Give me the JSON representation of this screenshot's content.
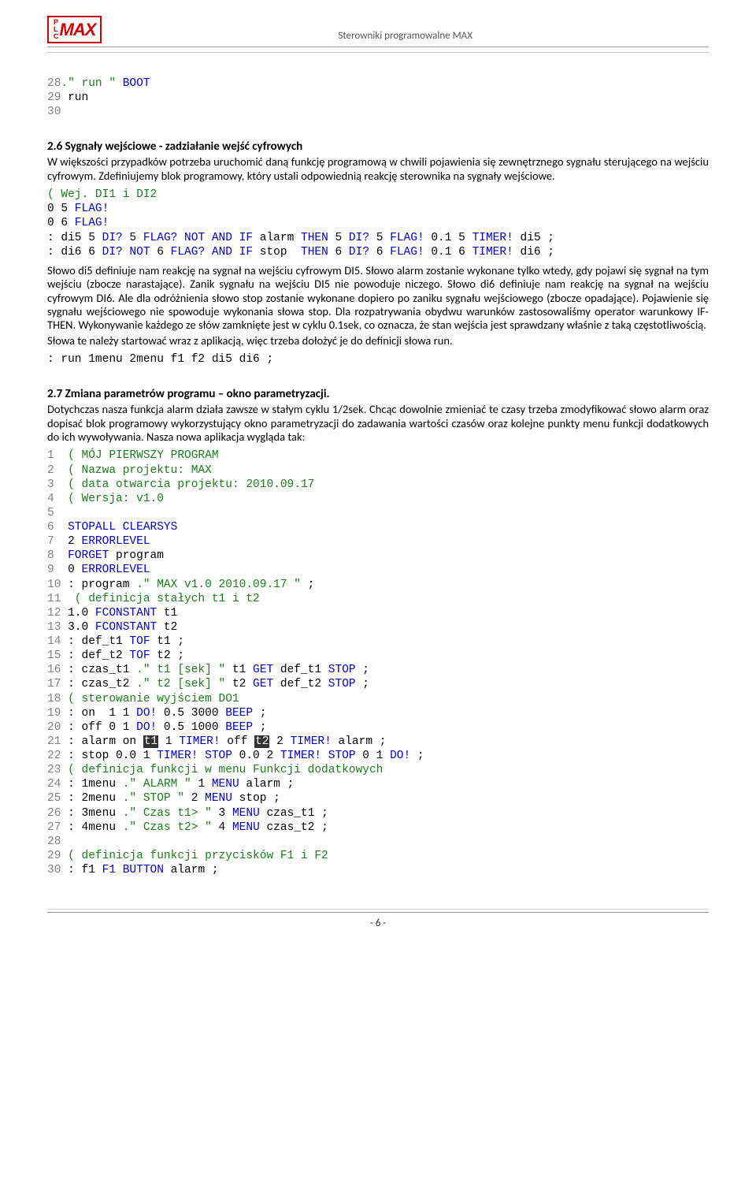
{
  "header": {
    "logo_small": "PLC",
    "logo_big": "MAX",
    "title": "Sterowniki programowalne MAX"
  },
  "code_top": {
    "l28_ln": "28",
    "l28_a": ".\" run \"",
    "l28_b": " BOOT",
    "l29_ln": "29",
    "l29_a": " run",
    "l30_ln": "30"
  },
  "section26": {
    "title": "2.6 Sygnały wejściowe - zadziałanie wejść cyfrowych",
    "p1": "W większości przypadków potrzeba uruchomić daną funkcję programową w chwili pojawienia się zewnętrznego sygnału sterującego na wejściu cyfrowym. Zdefiniujemy blok programowy, który ustali odpowiednią reakcję sterownika na sygnały wejściowe."
  },
  "code_di": {
    "c1": "( Wej. DI1 i DI2",
    "c2a": "0 5",
    "c2b": " FLAG!",
    "c3a": "0 6",
    "c3b": " FLAG!",
    "c4a": ": di5 5",
    "c4b": " DI?",
    "c4c": " 5",
    "c4d": " FLAG? NOT AND IF",
    "c4e": " alarm",
    "c4f": " THEN",
    "c4g": " 5",
    "c4h": " DI?",
    "c4i": " 5",
    "c4j": " FLAG!",
    "c4k": " 0.1 5",
    "c4l": " TIMER!",
    "c4m": " di5 ;",
    "c5a": ": di6 6",
    "c5b": " DI? NOT",
    "c5c": " 6",
    "c5d": " FLAG? AND IF",
    "c5e": " stop ",
    "c5f": " THEN",
    "c5g": " 6",
    "c5h": " DI?",
    "c5i": " 6",
    "c5j": " FLAG!",
    "c5k": " 0.1 6",
    "c5l": " TIMER!",
    "c5m": " di6 ;"
  },
  "para_di": "Słowo di5 definiuje nam reakcję na sygnał na wejściu cyfrowym DI5. Słowo alarm zostanie wykonane tylko wtedy, gdy pojawi się sygnał na tym wejściu (zbocze narastające). Zanik sygnału na wejściu DI5 nie powoduje niczego. Słowo di6 definiuje nam reakcję na sygnał na wejściu cyfrowym DI6. Ale dla odróżnienia słowo stop zostanie wykonane dopiero po zaniku sygnału wejściowego (zbocze opadające). Pojawienie się sygnału wejściowego nie spowoduje wykonania słowa stop. Dla rozpatrywania obydwu warunków zastosowaliśmy operator warunkowy IF-THEN. Wykonywanie każdego ze słów zamknięte jest w cyklu 0.1sek, co oznacza, że stan wejścia jest sprawdzany właśnie z taką częstotliwością.",
  "para_di2": "Słowa te należy startować wraz z aplikacją, więc trzeba dołożyć je do definicji słowa run.",
  "code_run": {
    "a": ": run 1menu 2menu f1 f2 di5 di6 ;"
  },
  "section27": {
    "title": "2.7 Zmiana parametrów programu – okno parametryzacji.",
    "p1": "Dotychczas nasza funkcja alarm działa zawsze w stałym cyklu 1/2sek. Chcąc dowolnie zmieniać te czasy trzeba zmodyfikować słowo alarm oraz dopisać blok programowy wykorzystujący okno parametryzacji do zadawania wartości czasów oraz kolejne punkty menu funkcji dodatkowych do ich wywoływania. Nasza nowa aplikacja wygląda tak:"
  },
  "code_main": {
    "l1_ln": "1",
    "l1": "  ( MÓJ PIERWSZY PROGRAM",
    "l2_ln": "2",
    "l2": "  ( Nazwa projektu: MAX",
    "l3_ln": "3",
    "l3": "  ( data otwarcia projektu: 2010.09.17",
    "l4_ln": "4",
    "l4": "  ( Wersja: v1.0",
    "l5_ln": "5",
    "l6_ln": "6",
    "l6a": "  STOPALL CLEARSYS",
    "l7_ln": "7",
    "l7a": "  2",
    "l7b": " ERRORLEVEL",
    "l8_ln": "8",
    "l8a": "  FORGET",
    "l8b": " program",
    "l9_ln": "9",
    "l9a": "  0",
    "l9b": " ERRORLEVEL",
    "l10_ln": "10",
    "l10a": " : program",
    "l10b": " .\" MAX v1.0 2010.09.17 \"",
    "l10c": " ;",
    "l11_ln": "11",
    "l11": "  ( definicja stałych t1 i t2",
    "l12_ln": "12",
    "l12a": " 1.0",
    "l12b": " FCONSTANT",
    "l12c": " t1",
    "l13_ln": "13",
    "l13a": " 3.0",
    "l13b": " FCONSTANT",
    "l13c": " t2",
    "l14_ln": "14",
    "l14a": " : def_t1",
    "l14b": " TOF",
    "l14c": " t1 ;",
    "l15_ln": "15",
    "l15a": " : def_t2",
    "l15b": " TOF",
    "l15c": " t2 ;",
    "l16_ln": "16",
    "l16a": " : czas_t1",
    "l16b": " .\" t1 [sek] \"",
    "l16c": " t1",
    "l16d": " GET",
    "l16e": " def_t1",
    "l16f": " STOP",
    "l16g": " ;",
    "l17_ln": "17",
    "l17a": " : czas_t2",
    "l17b": " .\" t2 [sek] \"",
    "l17c": " t2",
    "l17d": " GET",
    "l17e": " def_t2",
    "l17f": " STOP",
    "l17g": " ;",
    "l18_ln": "18",
    "l18": " ( sterowanie wyjściem DO1",
    "l19_ln": "19",
    "l19a": " : on  1 1",
    "l19b": " DO!",
    "l19c": " 0.5 3000",
    "l19d": " BEEP",
    "l19e": " ;",
    "l20_ln": "20",
    "l20a": " : off 0 1",
    "l20b": " DO!",
    "l20c": " 0.5 1000",
    "l20d": " BEEP",
    "l20e": " ;",
    "l21_ln": "21",
    "l21a": " : alarm on ",
    "l21hl1": "t1",
    "l21b": " 1",
    "l21c": " TIMER!",
    "l21d": " off ",
    "l21hl2": "t2",
    "l21e": " 2",
    "l21f": " TIMER!",
    "l21g": " alarm ;",
    "l22_ln": "22",
    "l22a": " : stop 0.0 1",
    "l22b": " TIMER! STOP",
    "l22c": " 0.0 2",
    "l22d": " TIMER! STOP",
    "l22e": " 0 1",
    "l22f": " DO!",
    "l22g": " ;",
    "l23_ln": "23",
    "l23": " ( definicja funkcji w menu Funkcji dodatkowych",
    "l24_ln": "24",
    "l24a": " : 1menu",
    "l24b": " .\" ALARM \"",
    "l24c": " 1",
    "l24d": " MENU",
    "l24e": " alarm ;",
    "l25_ln": "25",
    "l25a": " : 2menu",
    "l25b": " .\" STOP \"",
    "l25c": " 2",
    "l25d": " MENU",
    "l25e": " stop ;",
    "l26_ln": "26",
    "l26a": " : 3menu",
    "l26b": " .\" Czas t1> \"",
    "l26c": " 3",
    "l26d": " MENU",
    "l26e": " czas_t1 ;",
    "l27_ln": "27",
    "l27a": " : 4menu",
    "l27b": " .\" Czas t2> \"",
    "l27c": " 4",
    "l27d": " MENU",
    "l27e": " czas_t2 ;",
    "l28_ln": "28",
    "l29_ln": "29",
    "l29": " ( definicja funkcji przycisków F1 i F2",
    "l30_ln": "30",
    "l30a": " : f1",
    "l30b": " F1 BUTTON",
    "l30c": " alarm ;"
  },
  "footer": {
    "page": "- 6 -"
  }
}
